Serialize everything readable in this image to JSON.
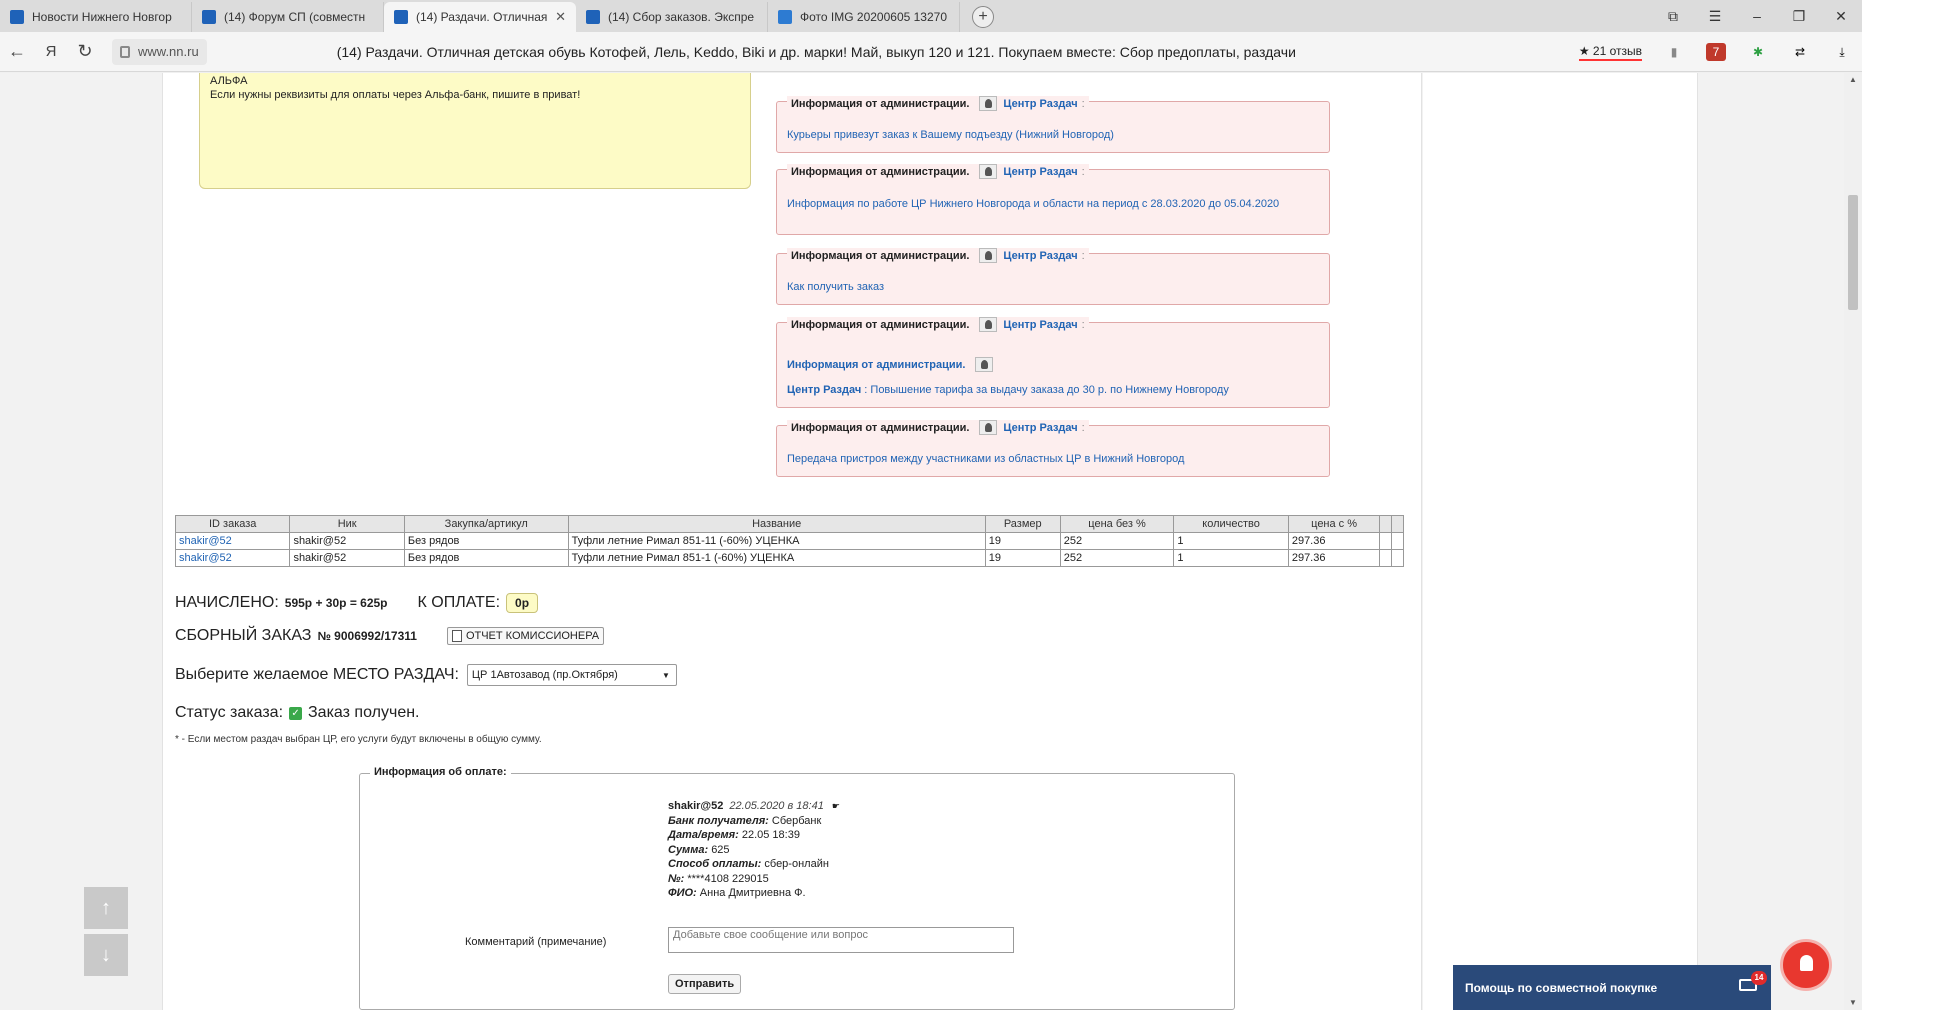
{
  "tabs": [
    {
      "label": "Новости Нижнего Новгор",
      "active": false
    },
    {
      "label": "(14) Форум СП (совместн",
      "active": false
    },
    {
      "label": "(14) Раздачи. Отличная",
      "active": true
    },
    {
      "label": "(14) Сбор заказов. Экспре",
      "active": false
    },
    {
      "label": "Фото IMG 20200605 13270",
      "active": false
    }
  ],
  "address": {
    "domain": "www.nn.ru",
    "title": "(14) Раздачи. Отличная детская обувь Котофей, Лель, Keddo, Biki и др. марки! Май, выкуп 120 и 121. Покупаем вместе: Сбор предоплаты, раздачи",
    "reviews": "★ 21 отзыв"
  },
  "yellow_note": {
    "line1": "АЛЬФА",
    "line2": "Если нужны реквизиты для оплаты через Альфа-банк, пишите в приват!"
  },
  "admin": {
    "header": "Информация от администрации.",
    "name": "Центр Раздач",
    "colon": ":",
    "items": [
      {
        "text": "Курьеры привезут заказ к Вашему подъезду (Нижний Новгород)"
      },
      {
        "text": "Информация по работе ЦР Нижнего Новгорода и области на период с 28.03.2020 до 05.04.2020"
      },
      {
        "text": "Как получить заказ"
      },
      {
        "text": "Повышение тарифа за выдачу заказа до 30 р. по Нижнему Новгороду"
      },
      {
        "text": "Передача пристроя между участниками из областных ЦР в Нижний Новгород"
      }
    ]
  },
  "table": {
    "headers": [
      "ID заказа",
      "Ник",
      "Закупка/артикул",
      "Название",
      "Размер",
      "цена без %",
      "количество",
      "цена с %",
      "",
      ""
    ],
    "rows": [
      [
        "shakir@52",
        "shakir@52",
        "Без рядов",
        "Туфли летние Римал 851-11 (-60%) УЦЕНКА",
        "19",
        "252",
        "1",
        "297.36",
        "",
        ""
      ],
      [
        "shakir@52",
        "shakir@52",
        "Без рядов",
        "Туфли летние Римал 851-1 (-60%) УЦЕНКА",
        "19",
        "252",
        "1",
        "297.36",
        "",
        ""
      ]
    ]
  },
  "summary": {
    "charged_label": "НАЧИСЛЕНО:",
    "charged_value": "595р + 30р = 625р",
    "topay_label": "К ОПЛАТЕ:",
    "topay_value": "0р",
    "combined_label": "СБОРНЫЙ ЗАКАЗ",
    "combined_value": "№ 9006992/17311",
    "report_button": "ОТЧЕТ КОМИССИОНЕРА",
    "place_label": "Выберите желаемое МЕСТО РАЗДАЧ:",
    "place_value": "ЦР 1Автозавод (пр.Октября)",
    "status_label": "Статус заказа:",
    "status_value": "Заказ получен.",
    "footnote": "* - Если местом раздач выбран ЦР, его услуги будут включены в общую сумму."
  },
  "payment": {
    "legend": "Информация об оплате:",
    "user": "shakir@52",
    "datetime": "22.05.2020 в 18:41",
    "fields": [
      {
        "label": "Банк получателя:",
        "value": "Сбербанк"
      },
      {
        "label": "Дата/время:",
        "value": "22.05 18:39"
      },
      {
        "label": "Сумма:",
        "value": "625"
      },
      {
        "label": "Способ оплаты:",
        "value": "сбер-онлайн"
      },
      {
        "label": "№:",
        "value": "****4108 229015"
      },
      {
        "label": "ФИО:",
        "value": "Анна Дмитриевна Ф."
      }
    ],
    "comment_label": "Комментарий (примечание)",
    "comment_placeholder": "Добавьте свое сообщение или вопрос",
    "send_button": "Отправить"
  },
  "help": {
    "label": "Помощь по совместной покупке",
    "badge": "14"
  },
  "colors": {
    "accent_link": "#2164b4",
    "admin_bg": "#fdeeee",
    "note_bg": "#fdfbc6",
    "help_bg": "#2a4a7a"
  }
}
